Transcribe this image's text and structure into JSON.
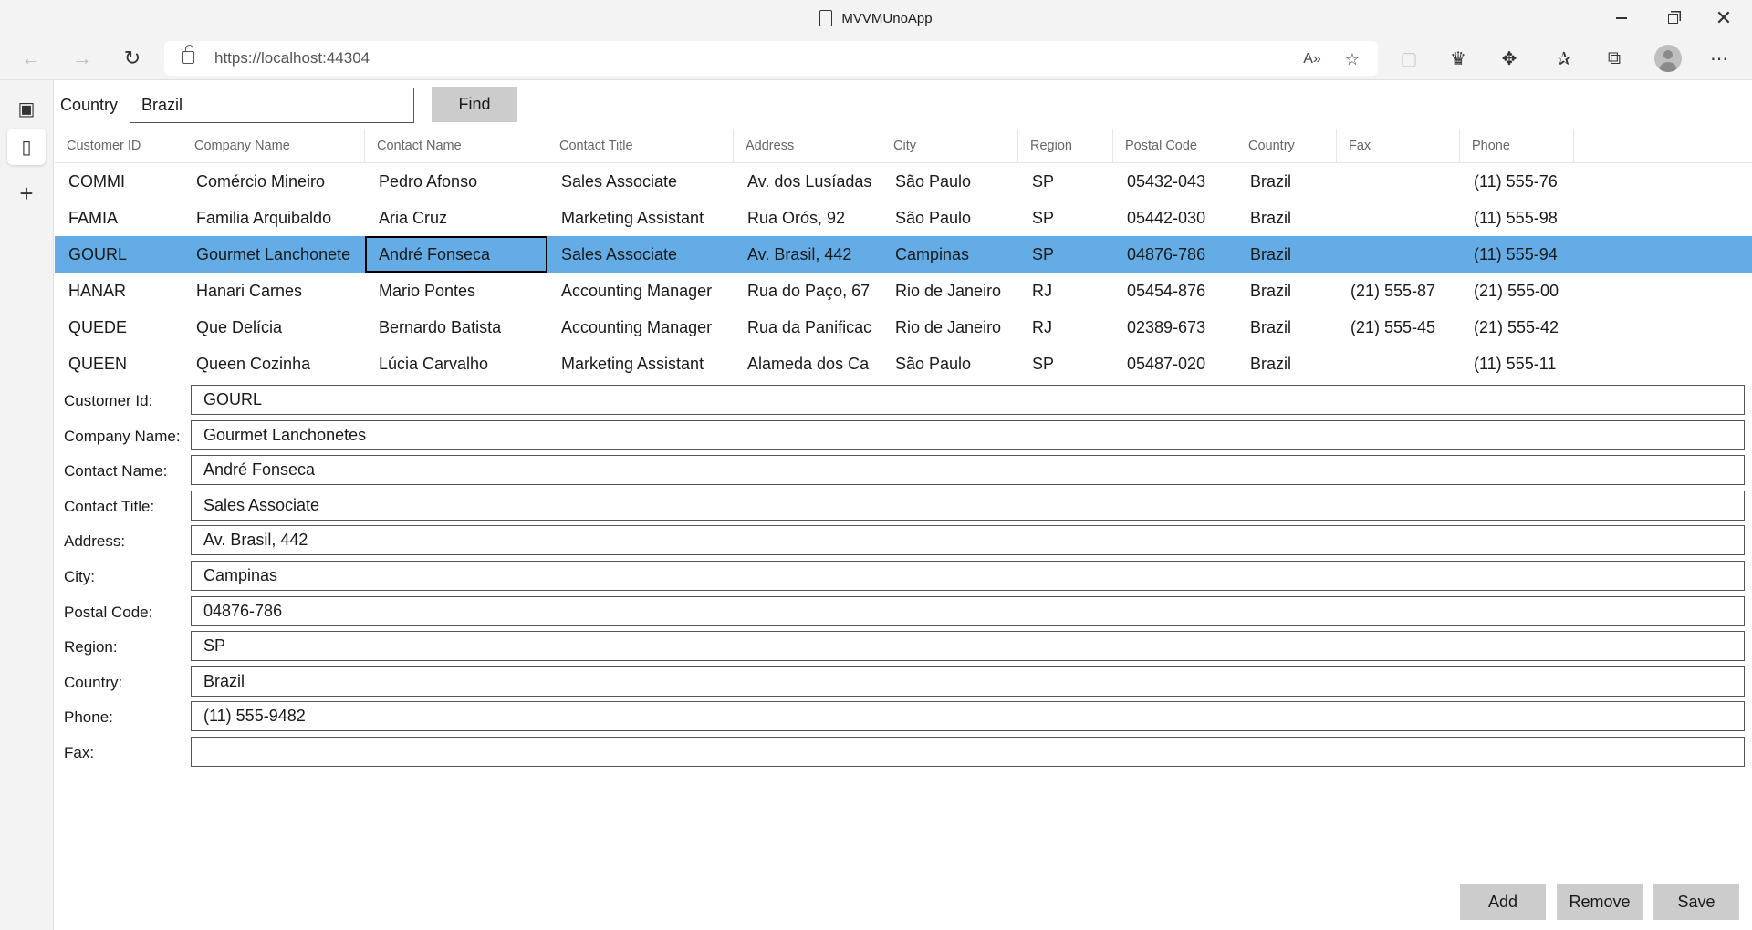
{
  "window": {
    "title": "MVVMUnoApp"
  },
  "browser": {
    "url": "https://localhost:44304",
    "icons": [
      "back-icon",
      "forward-icon",
      "reload-icon",
      "read-aloud-icon",
      "favorite-add-icon",
      "extension-icon",
      "favorites-icon",
      "collections-icon",
      "profile-icon",
      "more-icon"
    ]
  },
  "search": {
    "label": "Country",
    "value": "Brazil",
    "find_label": "Find"
  },
  "grid": {
    "columns": [
      "Customer ID",
      "Company Name",
      "Contact Name",
      "Contact Title",
      "Address",
      "City",
      "Region",
      "Postal Code",
      "Country",
      "Fax",
      "Phone"
    ],
    "rows": [
      [
        "COMMI",
        "Comércio Mineiro",
        "Pedro Afonso",
        "Sales Associate",
        "Av. dos Lusíadas",
        "São Paulo",
        "SP",
        "05432-043",
        "Brazil",
        "",
        "(11) 555-76"
      ],
      [
        "FAMIA",
        "Familia Arquibaldo",
        "Aria Cruz",
        "Marketing Assistant",
        "Rua Orós, 92",
        "São Paulo",
        "SP",
        "05442-030",
        "Brazil",
        "",
        "(11) 555-98"
      ],
      [
        "GOURL",
        "Gourmet Lanchonete",
        "André Fonseca",
        "Sales Associate",
        "Av. Brasil, 442",
        "Campinas",
        "SP",
        "04876-786",
        "Brazil",
        "",
        "(11) 555-94"
      ],
      [
        "HANAR",
        "Hanari Carnes",
        "Mario Pontes",
        "Accounting Manager",
        "Rua do Paço, 67",
        "Rio de Janeiro",
        "RJ",
        "05454-876",
        "Brazil",
        "(21) 555-87",
        "(21) 555-00"
      ],
      [
        "QUEDE",
        "Que Delícia",
        "Bernardo Batista",
        "Accounting Manager",
        "Rua da Panificac",
        "Rio de Janeiro",
        "RJ",
        "02389-673",
        "Brazil",
        "(21) 555-45",
        "(21) 555-42"
      ],
      [
        "QUEEN",
        "Queen Cozinha",
        "Lúcia Carvalho",
        "Marketing Assistant",
        "Alameda dos Ca",
        "São Paulo",
        "SP",
        "05487-020",
        "Brazil",
        "",
        "(11) 555-11"
      ]
    ],
    "selected_row": 2
  },
  "form": {
    "fields": [
      {
        "label": "Customer Id:",
        "value": "GOURL"
      },
      {
        "label": "Company Name:",
        "value": "Gourmet Lanchonetes"
      },
      {
        "label": "Contact Name:",
        "value": "André Fonseca"
      },
      {
        "label": "Contact Title:",
        "value": "Sales Associate"
      },
      {
        "label": "Address:",
        "value": "Av. Brasil, 442"
      },
      {
        "label": "City:",
        "value": "Campinas"
      },
      {
        "label": "Postal Code:",
        "value": "04876-786"
      },
      {
        "label": "Region:",
        "value": "SP"
      },
      {
        "label": "Country:",
        "value": "Brazil"
      },
      {
        "label": "Phone:",
        "value": "(11) 555-9482"
      },
      {
        "label": "Fax:",
        "value": ""
      }
    ]
  },
  "actions": {
    "add": "Add",
    "remove": "Remove",
    "save": "Save"
  },
  "colors": {
    "selection": "#63ace5",
    "button": "#cccccc",
    "chrome": "#f3f3f3"
  }
}
